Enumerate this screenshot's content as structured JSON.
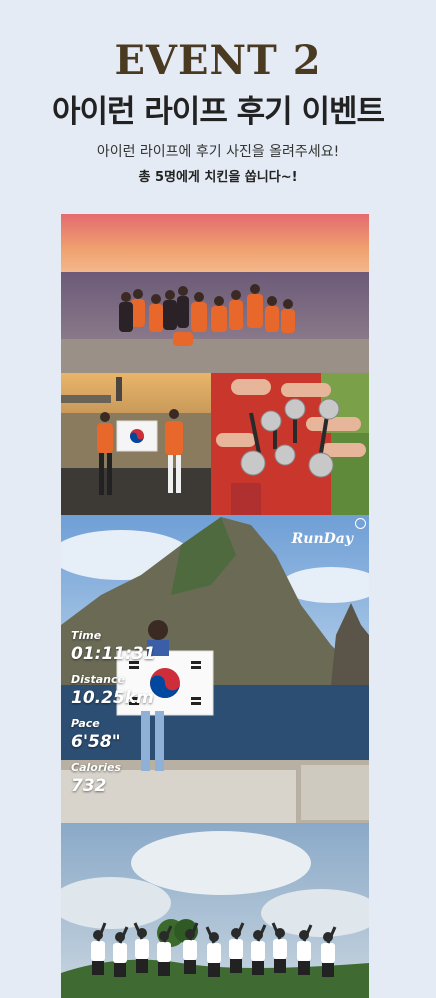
{
  "header": {
    "event_label": "EVENT 2",
    "title": "아이런 라이프 후기 이벤트",
    "subtitle": "아이런 라이프에 후기 사진을 올려주세요!",
    "prize": "총 5명에게 치킨을 쏩니다~!"
  },
  "photos": {
    "runday_logo": "RunDay",
    "stats": [
      {
        "label": "Time",
        "value": "01:11:31"
      },
      {
        "label": "Distance",
        "value": "10.25km"
      },
      {
        "label": "Pace",
        "value": "6'58\""
      },
      {
        "label": "Calories",
        "value": "732"
      }
    ]
  }
}
